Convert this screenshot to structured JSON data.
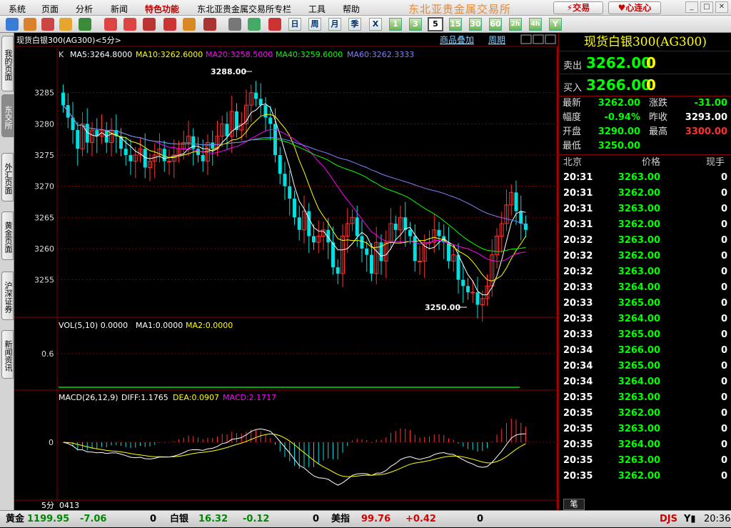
{
  "menu": {
    "items": [
      "系统",
      "页面",
      "分析",
      "新闻",
      "特色功能",
      "东北亚贵金属交易所专栏",
      "工具",
      "帮助"
    ],
    "brand": "东北亚贵金属交易所",
    "trade_btn": "交易",
    "xinlian_btn": "心连心"
  },
  "toolbar": {
    "periods": [
      "1",
      "3",
      "5",
      "15",
      "30",
      "60",
      "2h",
      "4h",
      "Y"
    ],
    "selected_period": "5",
    "glyphs": [
      "日",
      "周",
      "月",
      "季",
      "X"
    ]
  },
  "side_tabs": [
    "我的页面",
    "东交所",
    "外汇页面",
    "黄金页面",
    "沪深证券",
    "新闻资讯"
  ],
  "chart": {
    "header_left": "现货白银300(AG300)<5分>",
    "header_links": [
      "商品叠加",
      "周期"
    ],
    "ma_line": {
      "k": "K",
      "ma5": "MA5:3264.8000",
      "ma10": "MA10:3262.6000",
      "ma20": "MA20:3258.5000",
      "ma40": "MA40:3259.6000",
      "ma60": "MA60:3262.3333"
    },
    "price_ticks": [
      "3285",
      "3280",
      "3275",
      "3270",
      "3265",
      "3260",
      "3255"
    ],
    "high_label": "3288.00",
    "low_label": "3250.00",
    "vol_header": {
      "vol": "VOL(5,10) 0.0000",
      "ma1": "MA1:0.0000",
      "ma2": "MA2:0.0000"
    },
    "vol_tick": "0.6",
    "macd_header": {
      "name": "MACD(26,12,9)",
      "diff": "DIFF:1.1765",
      "dea": "DEA:0.0907",
      "macd": "MACD:2.1717"
    },
    "macd_tick": "0",
    "bottom_left": "5分",
    "bottom_code": "0413",
    "colors": {
      "up": "#ff3232",
      "down": "#00e0e0",
      "ma5": "#ffffff",
      "ma10": "#ffff00",
      "ma20": "#ff00ff",
      "ma40": "#00ff00",
      "ma60": "#8080ff"
    }
  },
  "quote": {
    "title": "现货白银300(AG300)",
    "sell_label": "卖出",
    "sell_price": "3262.00",
    "sell_qty": "0",
    "buy_label": "买入",
    "buy_price": "3266.00",
    "buy_qty": "0",
    "fields": [
      {
        "label": "最新",
        "value": "3262.00",
        "label2": "涨跌",
        "value2": "-31.00"
      },
      {
        "label": "幅度",
        "value": "-0.94%",
        "label2": "昨收",
        "value2": "3293.00"
      },
      {
        "label": "开盘",
        "value": "3290.00",
        "label2": "最高",
        "value2": "3300.00"
      },
      {
        "label": "最低",
        "value": "3250.00",
        "label2": "",
        "value2": ""
      }
    ],
    "tick_headers": [
      "北京",
      "价格",
      "现手"
    ],
    "ticks": [
      {
        "t": "20:31",
        "p": "3263.00",
        "v": "0"
      },
      {
        "t": "20:31",
        "p": "3262.00",
        "v": "0"
      },
      {
        "t": "20:31",
        "p": "3263.00",
        "v": "0"
      },
      {
        "t": "20:31",
        "p": "3262.00",
        "v": "0"
      },
      {
        "t": "20:32",
        "p": "3263.00",
        "v": "0"
      },
      {
        "t": "20:32",
        "p": "3262.00",
        "v": "0"
      },
      {
        "t": "20:32",
        "p": "3263.00",
        "v": "0"
      },
      {
        "t": "20:33",
        "p": "3264.00",
        "v": "0"
      },
      {
        "t": "20:33",
        "p": "3265.00",
        "v": "0"
      },
      {
        "t": "20:33",
        "p": "3264.00",
        "v": "0"
      },
      {
        "t": "20:33",
        "p": "3265.00",
        "v": "0"
      },
      {
        "t": "20:34",
        "p": "3266.00",
        "v": "0"
      },
      {
        "t": "20:34",
        "p": "3265.00",
        "v": "0"
      },
      {
        "t": "20:34",
        "p": "3264.00",
        "v": "0"
      },
      {
        "t": "20:35",
        "p": "3263.00",
        "v": "0"
      },
      {
        "t": "20:35",
        "p": "3262.00",
        "v": "0"
      },
      {
        "t": "20:35",
        "p": "3263.00",
        "v": "0"
      },
      {
        "t": "20:35",
        "p": "3264.00",
        "v": "0"
      },
      {
        "t": "20:35",
        "p": "3263.00",
        "v": "0"
      },
      {
        "t": "20:35",
        "p": "3262.00",
        "v": "0"
      }
    ],
    "tab_label": "笔"
  },
  "status": {
    "gold_label": "黄金",
    "gold_price": "1199.95",
    "gold_chg": "-7.06",
    "gold_vol": "0",
    "silver_label": "白银",
    "silver_price": "16.32",
    "silver_chg": "-0.12",
    "silver_vol": "0",
    "usd_label": "美指",
    "usd_price": "99.76",
    "usd_chg": "+0.42",
    "usd_vol": "0",
    "djs": "DJS",
    "time": "20:36"
  },
  "chart_data": {
    "type": "candlestick",
    "title": "现货白银300(AG300)<5分>",
    "ylim": [
      3250,
      3290
    ],
    "high": 3288.0,
    "low": 3250.0,
    "close_series": [
      3283,
      3281,
      3279,
      3276,
      3280,
      3277,
      3279,
      3278,
      3279,
      3277,
      3279,
      3278,
      3276,
      3275,
      3274,
      3275,
      3276,
      3273,
      3274,
      3275,
      3276,
      3274,
      3274,
      3275,
      3276,
      3277,
      3278,
      3276,
      3275,
      3274,
      3277,
      3276,
      3278,
      3280,
      3278,
      3282,
      3279,
      3280,
      3283,
      3285,
      3284,
      3283,
      3281,
      3280,
      3275,
      3272,
      3270,
      3268,
      3265,
      3263,
      3266,
      3262,
      3261,
      3262,
      3263,
      3261,
      3257,
      3256,
      3262,
      3264,
      3265,
      3262,
      3260,
      3259,
      3256,
      3261,
      3258,
      3261,
      3264,
      3263,
      3265,
      3263,
      3262,
      3258,
      3258,
      3261,
      3261,
      3263,
      3262,
      3261,
      3258,
      3259,
      3255,
      3254,
      3253,
      3253,
      3251,
      3252,
      3254,
      3259,
      3262,
      3264,
      3267,
      3269,
      3266,
      3264,
      3263
    ],
    "macd": {
      "diff": 1.1765,
      "dea": 0.0907,
      "macd": 2.1717
    }
  }
}
